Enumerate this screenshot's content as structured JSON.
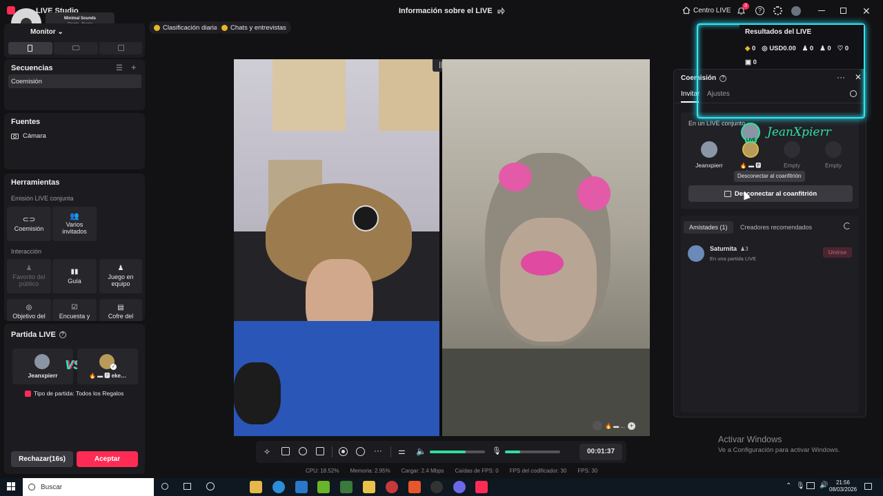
{
  "app": {
    "title": "LIVE Studio",
    "center_title": "Información sobre el LIVE",
    "centro_live": "Centro LIVE",
    "notif_count": "3"
  },
  "music": {
    "title": "Minimal Sounds",
    "subtitle": "Chezile - Beanie"
  },
  "left": {
    "monitor_label": "Monitor",
    "secuencias": "Secuencias",
    "secuencia_item": "Coemisión",
    "fuentes": "Fuentes",
    "camara": "Cámara",
    "herramientas": "Herramientas",
    "emision_conjunta": "Emisión LIVE conjunta",
    "coemision": "Coemisión",
    "varios": "Varios invitados",
    "interaccion": "Interacción",
    "favorito": "Favorito del público",
    "guia": "Guía",
    "juego": "Juego en equipo",
    "objetivo": "Objetivo del",
    "encuesta": "Encuesta y",
    "cofre": "Cofre del"
  },
  "partida": {
    "title": "Partida LIVE",
    "player1": "Jeanxpierr",
    "vs": "VS",
    "player2": "🔥 ▬ 🅿 eke…",
    "tipo": "Tipo de partida: Todos los Regalos",
    "rechazar": "Rechazar(16s)",
    "aceptar": "Aceptar"
  },
  "pills": {
    "clasificacion": "Clasificación diaria",
    "chats": "Chats y entrevistas"
  },
  "resultados": {
    "title": "Resultados del LIVE",
    "diamonds": "0",
    "usd": "USD0.00",
    "viewers": "0",
    "followers": "0",
    "likes": "0",
    "gifts": "0"
  },
  "coemision": {
    "title": "Coemisión",
    "tab_invitar": "Invitar",
    "tab_ajustes": "Ajustes",
    "en_live": "En un LIVE conjunto",
    "overlay_name": "JeanXpierr",
    "live_badge": "LIVE",
    "slot1": "Jeanxpierr",
    "slot2": "🔥 ▬ 🅿 eke…",
    "slot3": "Empty",
    "slot4": "Empty",
    "tooltip": "Desconectar al coanfitrión",
    "disconnect": "Desconectar al coanfitrión",
    "amistades": "Amistades (1)",
    "creadores": "Creadores recomendados",
    "friend_name": "Saturnita",
    "friend_count": "3",
    "friend_status": "En una partida LIVE",
    "unirse": "Unirse"
  },
  "video": {
    "mini_badge": "🔥 ▬ ..."
  },
  "controls": {
    "timer": "00:01:37"
  },
  "stats": {
    "cpu": "CPU:  18.52%",
    "memoria": "Memoria:  2.95%",
    "cargar": "Cargar:  2.4 Mbps",
    "caidas": "Caídas de FPS:  0",
    "fps_cod": "FPS del codificador:  30",
    "fps": "FPS:  30"
  },
  "windows": {
    "activar": "Activar Windows",
    "activar_sub": "Ve a Configuración para activar Windows.",
    "buscar": "Buscar",
    "time": "21:56",
    "date": "08/03/2026"
  },
  "colors": {
    "accent": "#fe2c55",
    "cyan": "#2ee6f5",
    "green": "#2ee0a0"
  }
}
